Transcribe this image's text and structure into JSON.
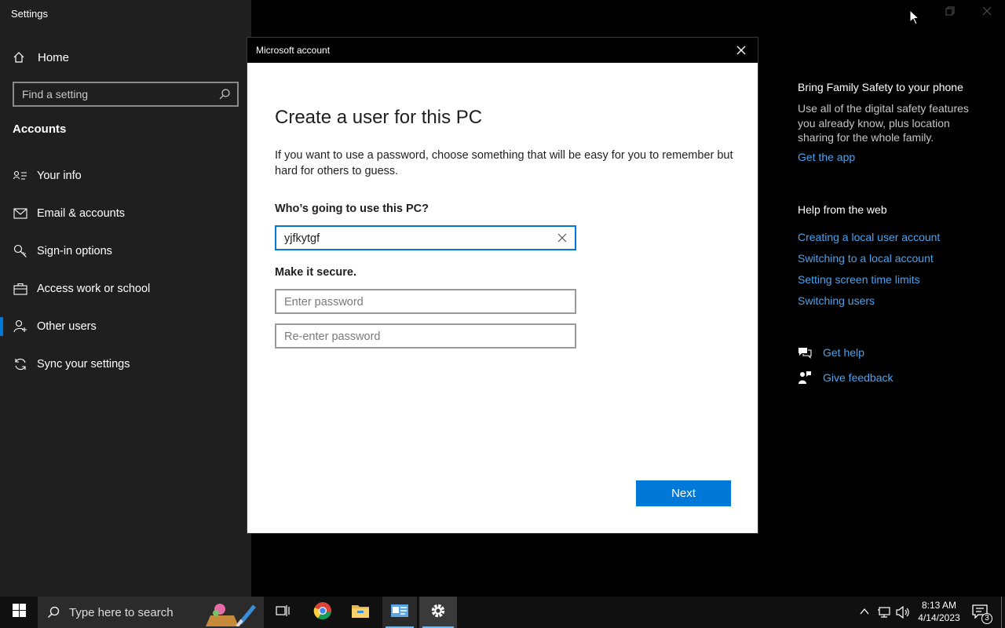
{
  "app": {
    "title": "Settings"
  },
  "sidebar": {
    "home": "Home",
    "search_placeholder": "Find a setting",
    "section": "Accounts",
    "items": [
      {
        "label": "Your info",
        "icon": "user-card-icon"
      },
      {
        "label": "Email & accounts",
        "icon": "mail-icon"
      },
      {
        "label": "Sign-in options",
        "icon": "key-icon"
      },
      {
        "label": "Access work or school",
        "icon": "briefcase-icon"
      },
      {
        "label": "Other users",
        "icon": "person-add-icon",
        "active": true
      },
      {
        "label": "Sync your settings",
        "icon": "sync-icon"
      }
    ]
  },
  "right_pane": {
    "family_heading": "Bring Family Safety to your phone",
    "family_text": "Use all of the digital safety features you already know, plus location sharing for the whole family.",
    "family_link": "Get the app",
    "web_heading": "Help from the web",
    "web_links": [
      "Creating a local user account",
      "Switching to a local account",
      "Setting screen time limits",
      "Switching users"
    ],
    "get_help": "Get help",
    "give_feedback": "Give feedback"
  },
  "dialog": {
    "title": "Microsoft account",
    "heading": "Create a user for this PC",
    "description": "If you want to use a password, choose something that will be easy for you to remember but hard for others to guess.",
    "who_label": "Who’s going to use this PC?",
    "username_value": "yjfkytgf",
    "secure_label": "Make it secure.",
    "password_placeholder": "Enter password",
    "reenter_placeholder": "Re-enter password",
    "next_label": "Next"
  },
  "taskbar": {
    "search_placeholder": "Type here to search",
    "time": "8:13 AM",
    "date": "4/14/2023",
    "notification_count": "3",
    "accent": "#0078d7"
  }
}
